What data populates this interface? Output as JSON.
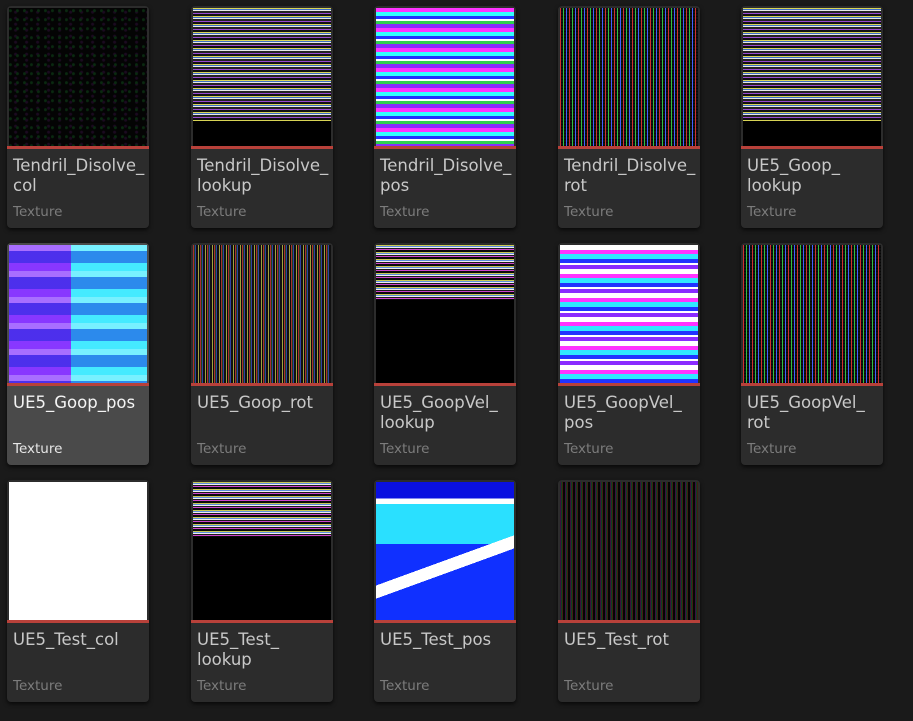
{
  "assets": [
    {
      "name": "Tendril_Disolve_col",
      "type": "Texture",
      "selected": false,
      "thumb": "t-dark"
    },
    {
      "name": "Tendril_Disolve_lookup",
      "type": "Texture",
      "selected": false,
      "thumb": "t-lookup"
    },
    {
      "name": "Tendril_Disolve_pos",
      "type": "Texture",
      "selected": false,
      "thumb": "t-pos"
    },
    {
      "name": "Tendril_Disolve_rot",
      "type": "Texture",
      "selected": false,
      "thumb": "t-noise"
    },
    {
      "name": "UE5_Goop_lookup",
      "type": "Texture",
      "selected": false,
      "thumb": "t-lookup"
    },
    {
      "name": "UE5_Goop_pos",
      "type": "Texture",
      "selected": true,
      "thumb": "t-goop"
    },
    {
      "name": "UE5_Goop_rot",
      "type": "Texture",
      "selected": false,
      "thumb": "t-rot"
    },
    {
      "name": "UE5_GoopVel_lookup",
      "type": "Texture",
      "selected": false,
      "thumb": "t-lookup2"
    },
    {
      "name": "UE5_GoopVel_pos",
      "type": "Texture",
      "selected": false,
      "thumb": "t-vpos"
    },
    {
      "name": "UE5_GoopVel_rot",
      "type": "Texture",
      "selected": false,
      "thumb": "t-noise"
    },
    {
      "name": "UE5_Test_col",
      "type": "Texture",
      "selected": false,
      "thumb": "t-white"
    },
    {
      "name": "UE5_Test_lookup",
      "type": "Texture",
      "selected": false,
      "thumb": "t-lookup2"
    },
    {
      "name": "UE5_Test_pos",
      "type": "Texture",
      "selected": false,
      "thumb": "t-testpos"
    },
    {
      "name": "UE5_Test_rot",
      "type": "Texture",
      "selected": false,
      "thumb": "t-testrot"
    }
  ],
  "colors": {
    "background": "#1a1a1a",
    "tile": "#2c2c2c",
    "tile_selected": "#4a4a4a",
    "asset_type_bar": "#b8413a"
  }
}
